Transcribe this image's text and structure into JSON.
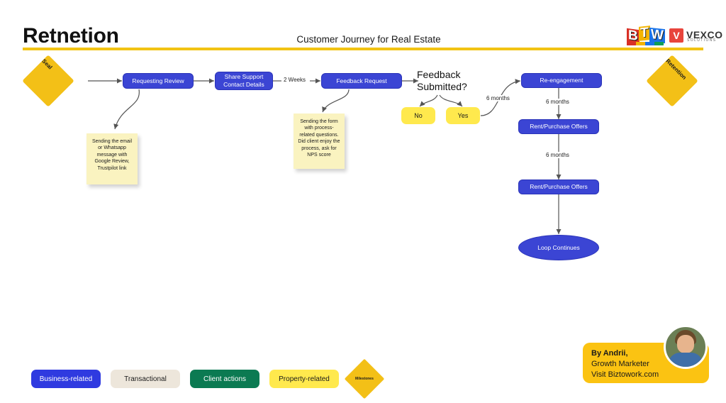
{
  "header": {
    "title": "Retnetion",
    "subtitle": "Customer Journey for Real Estate",
    "logo_btw": "BTW",
    "logo_vexco_mark": "V",
    "logo_vexco_name": "VEXCO",
    "logo_vexco_sub": "SOLUTIONS"
  },
  "flow": {
    "start_milestone": "Seal",
    "end_milestone": "Retention",
    "nodes": [
      {
        "id": "requesting-review",
        "label": "Requesting Review"
      },
      {
        "id": "share-support-contact-details",
        "label": "Share Support\nContact Details"
      },
      {
        "id": "feedback-request",
        "label": "Feedback Request"
      },
      {
        "id": "re-engagement",
        "label": "Re-engagement"
      },
      {
        "id": "rent-purchase-offers-1",
        "label": "Rent/Purchase Offers"
      },
      {
        "id": "rent-purchase-offers-2",
        "label": "Rent/Purchase Offers"
      },
      {
        "id": "loop-continues",
        "label": "Loop Continues"
      }
    ],
    "decision": {
      "line1": "Feedback",
      "line2": "Submitted?",
      "option_no": "No",
      "option_yes": "Yes"
    },
    "edge_labels": {
      "two_weeks": "2 Weeks",
      "six_months_yes": "6 months",
      "six_months_1": "6 months",
      "six_months_2": "6 months"
    },
    "notes": [
      {
        "id": "note-review-channels",
        "text": "Sending the email or Whatsapp message with Google Review, Trustpilot link"
      },
      {
        "id": "note-feedback-form",
        "text": "Sending the form with process-related questions. Did client enjoy the process, ask for NPS score"
      }
    ]
  },
  "legend": {
    "items": [
      {
        "id": "business-related",
        "label": "Business-related",
        "color": "#2F3AE0"
      },
      {
        "id": "transactional",
        "label": "Transactional",
        "color": "#EDE6DB"
      },
      {
        "id": "client-actions",
        "label": "Client actions",
        "color": "#0B7A52"
      },
      {
        "id": "property-related",
        "label": "Property-related",
        "color": "#FFE94D"
      },
      {
        "id": "milestones",
        "label": "Milestones",
        "color": "#F3C017"
      }
    ]
  },
  "author": {
    "name": "By Andrii,",
    "role": "Growth Marketer",
    "site": "Visit Biztowork.com"
  }
}
